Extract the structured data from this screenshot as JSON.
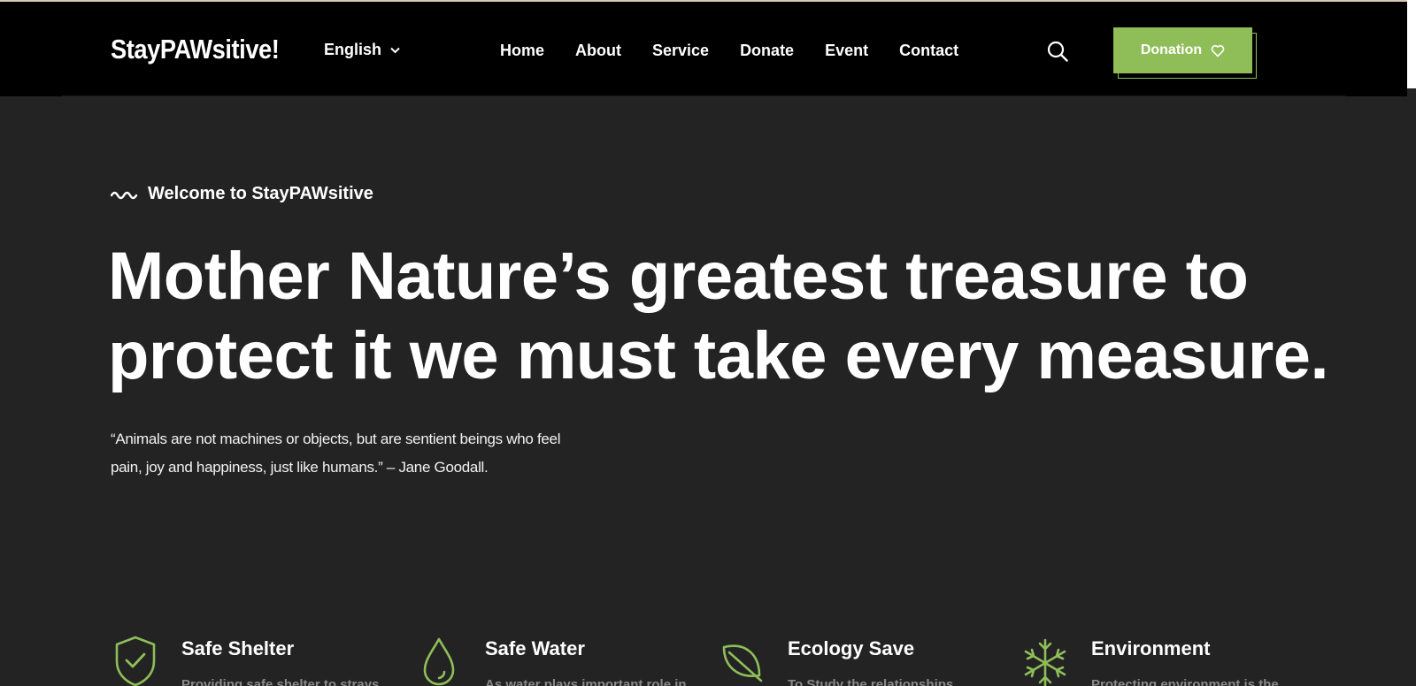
{
  "header": {
    "logo": "StayPAWsitive!",
    "language": "English",
    "nav": [
      "Home",
      "About",
      "Service",
      "Donate",
      "Event",
      "Contact"
    ],
    "donate_label": "Donation"
  },
  "hero": {
    "welcome": "Welcome to StayPAWsitive",
    "headline_line1": "Mother Nature’s greatest treasure to",
    "headline_line2": "protect it we must take every measure.",
    "quote_line1": "“Animals are not machines or objects, but are sentient beings who feel",
    "quote_line2": "pain, joy and happiness, just like humans.” – Jane Goodall."
  },
  "features": [
    {
      "title": "Safe Shelter",
      "desc": "Providing safe shelter to strays",
      "icon": "shield-check-icon"
    },
    {
      "title": "Safe Water",
      "desc": "As water plays important role in",
      "icon": "water-drop-icon"
    },
    {
      "title": "Ecology Save",
      "desc": "To Study the relationships",
      "icon": "leaf-icon"
    },
    {
      "title": "Environment",
      "desc": "Protecting environment is the",
      "icon": "snowflake-icon"
    }
  ],
  "colors": {
    "accent": "#8fbe58",
    "header_bg": "#000000",
    "page_bg": "#232323"
  }
}
